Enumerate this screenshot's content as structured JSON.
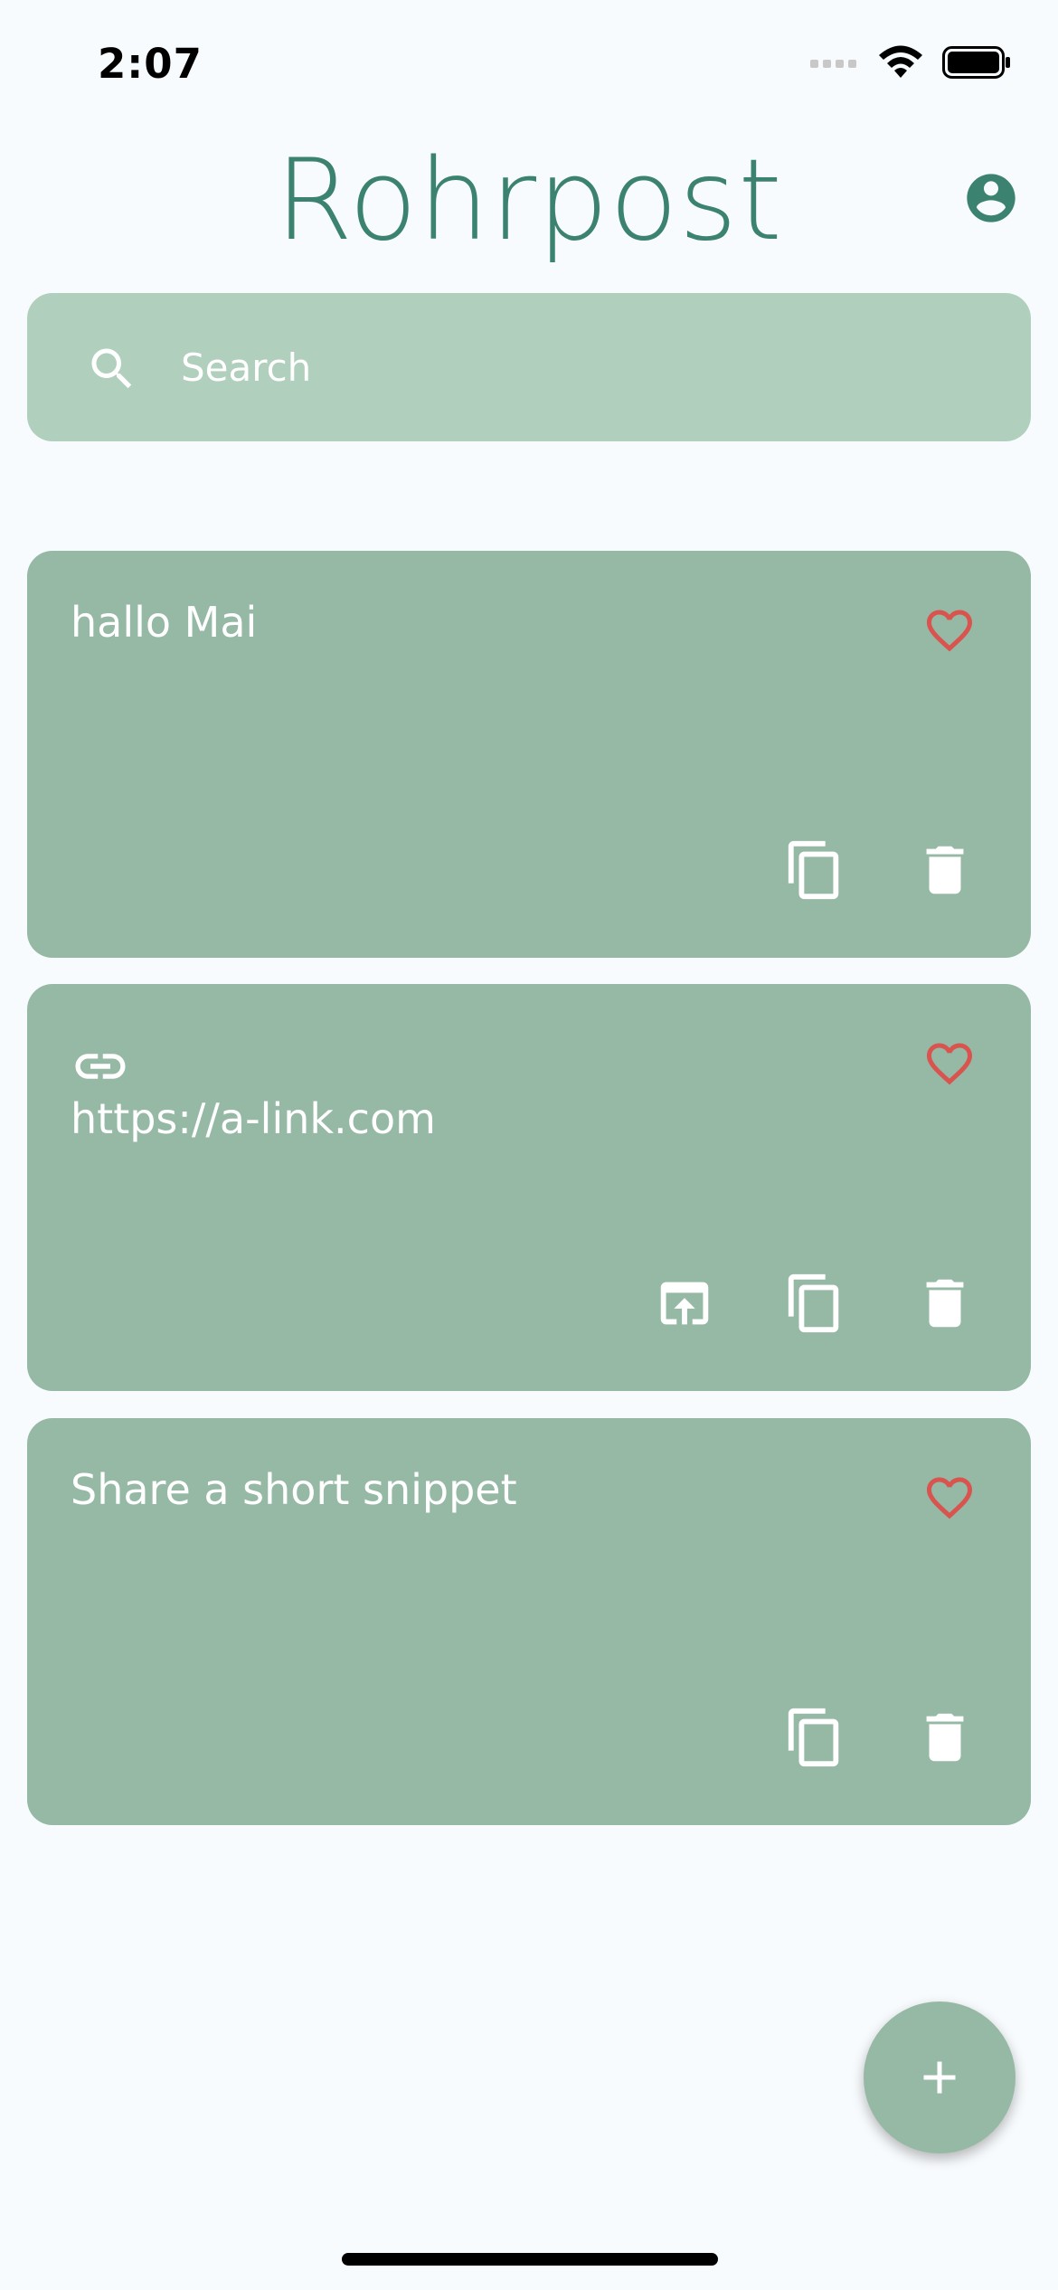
{
  "status_bar": {
    "time": "2:07"
  },
  "header": {
    "title": "Rohrpost",
    "account_icon": "account-circle-icon"
  },
  "search": {
    "placeholder": "Search",
    "value": "",
    "icon": "search-icon"
  },
  "snippets": [
    {
      "text": "hallo Mai",
      "is_link": false,
      "favorite": false,
      "actions": [
        "copy",
        "delete"
      ]
    },
    {
      "text": "https://a-link.com",
      "is_link": true,
      "favorite": false,
      "actions": [
        "open",
        "copy",
        "delete"
      ]
    },
    {
      "text": "Share a short snippet",
      "is_link": false,
      "favorite": false,
      "actions": [
        "copy",
        "delete"
      ]
    }
  ],
  "fab": {
    "icon": "plus-icon"
  },
  "colors": {
    "title": "#3b8270",
    "search_bg": "#b1cfbd",
    "card_bg": "#95b9a4",
    "favorite": "#d9534f",
    "background": "#f8fbfd"
  }
}
